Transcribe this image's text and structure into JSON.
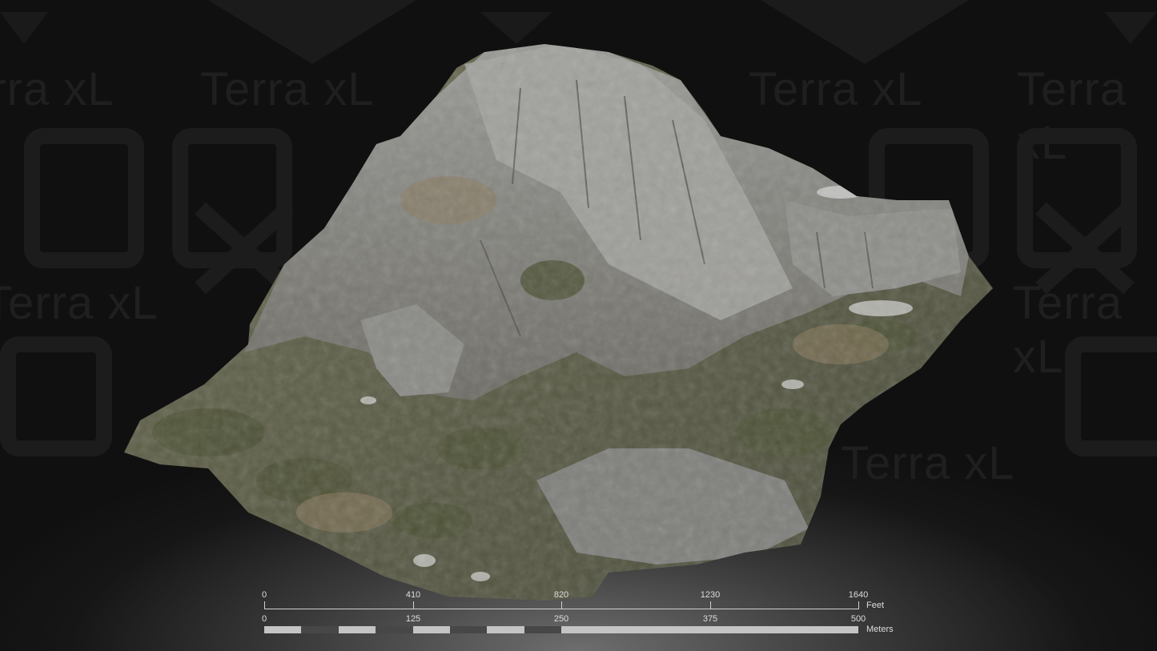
{
  "watermark": {
    "brand": "Terra xL",
    "logo_icon": "terra-xl-logo-icon"
  },
  "model": {
    "subject": "3D terrain mesh",
    "icon": "mountain-terrain-model"
  },
  "scale_bar": {
    "feet": {
      "ticks": [
        "0",
        "410",
        "820",
        "1230",
        "1640"
      ],
      "unit": "Feet"
    },
    "meters": {
      "ticks": [
        "0",
        "125",
        "250",
        "375",
        "500"
      ],
      "unit": "Meters"
    },
    "colors": {
      "light": "#c4c4c4",
      "dark": "#474747",
      "line": "#cfcfcf",
      "text": "#dcdcdc"
    }
  }
}
